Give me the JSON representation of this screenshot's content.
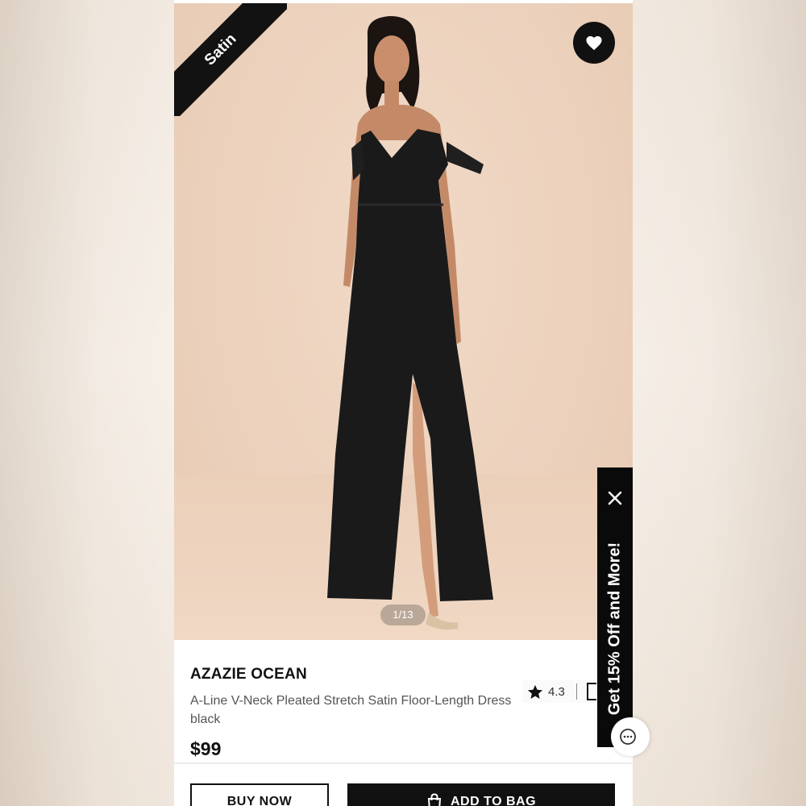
{
  "badge": {
    "label": "Satin"
  },
  "gallery": {
    "counter": "1/13"
  },
  "product": {
    "brand": "AZAZIE OCEAN",
    "name": "A-Line V-Neck Pleated Stretch Satin Floor-Length Dress black",
    "price": "$99",
    "rating": "4.3"
  },
  "actions": {
    "buy_now": "BUY NOW",
    "add_to_bag": "ADD TO BAG"
  },
  "promo": {
    "text": "Get 15% Off and More!"
  },
  "icons": {
    "favorite": "heart-icon",
    "rating": "star-icon",
    "close": "close-icon",
    "bag": "shopping-bag-icon",
    "chat": "chat-icon"
  },
  "colors": {
    "accent": "#111111",
    "photo_background": "#ecd2bd",
    "dress": "#1a1a1a"
  }
}
